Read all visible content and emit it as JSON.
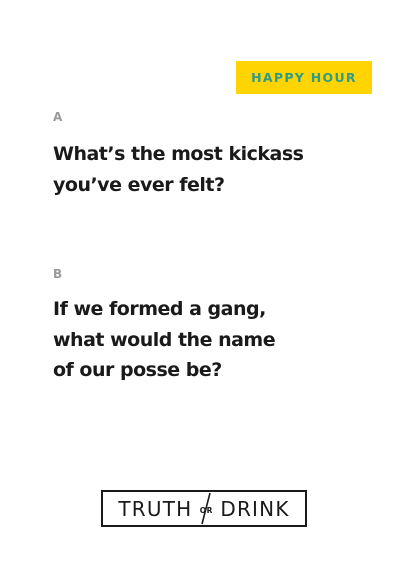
{
  "badge": {
    "label": "HAPPY HOUR"
  },
  "questions": [
    {
      "letter": "A",
      "text": "What’s the most kickass\nyou’ve ever felt?"
    },
    {
      "letter": "B",
      "text": "If we formed a gang,\nwhat would the name\nof our posse be?"
    }
  ],
  "logo": {
    "left_word": "TRUTH",
    "connector": "OR",
    "right_word": "DRINK"
  },
  "colors": {
    "badge_bg": "#ffd400",
    "badge_text": "#2e9c86",
    "text": "#1a1a1a",
    "letter": "#9a9a9a"
  }
}
